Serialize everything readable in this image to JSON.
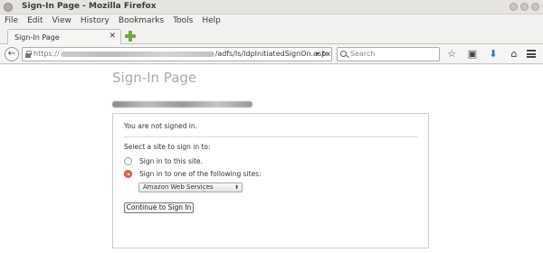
{
  "window": {
    "title": "Sign-In Page - Mozilla Firefox"
  },
  "menubar": {
    "items": [
      "File",
      "Edit",
      "View",
      "History",
      "Bookmarks",
      "Tools",
      "Help"
    ]
  },
  "tab": {
    "label": "Sign-In Page"
  },
  "address": {
    "scheme": "https://",
    "path": "/adfs/ls/IdpInitiatedSignOn.aspx"
  },
  "search": {
    "placeholder": "Search"
  },
  "page": {
    "title": "Sign-In Page",
    "status": "You are not signed in.",
    "prompt": "Select a site to sign in to:",
    "option_this_site": "Sign in to this site.",
    "option_other_sites": "Sign in to one of the following sites:",
    "selected_site": "Amazon Web Services",
    "continue_label": "Continue to Sign In"
  },
  "colors": {
    "download_icon": "#1f73d8",
    "new_tab_icon": "#6fa842",
    "radio_checked": "#e0704e"
  }
}
